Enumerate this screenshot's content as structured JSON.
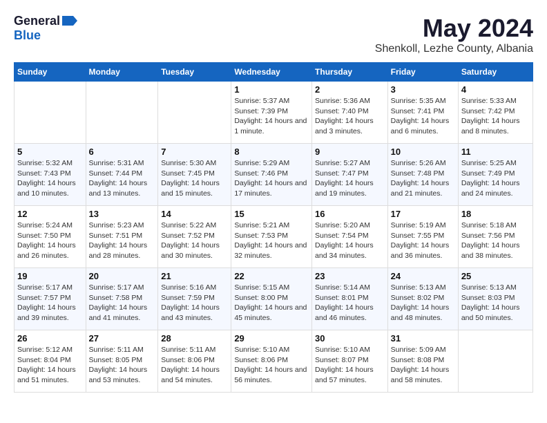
{
  "logo": {
    "general": "General",
    "blue": "Blue"
  },
  "header": {
    "month": "May 2024",
    "location": "Shenkoll, Lezhe County, Albania"
  },
  "days_of_week": [
    "Sunday",
    "Monday",
    "Tuesday",
    "Wednesday",
    "Thursday",
    "Friday",
    "Saturday"
  ],
  "weeks": [
    [
      {
        "day": null
      },
      {
        "day": null
      },
      {
        "day": null
      },
      {
        "day": 1,
        "sunrise": "Sunrise: 5:37 AM",
        "sunset": "Sunset: 7:39 PM",
        "daylight": "Daylight: 14 hours and 1 minute."
      },
      {
        "day": 2,
        "sunrise": "Sunrise: 5:36 AM",
        "sunset": "Sunset: 7:40 PM",
        "daylight": "Daylight: 14 hours and 3 minutes."
      },
      {
        "day": 3,
        "sunrise": "Sunrise: 5:35 AM",
        "sunset": "Sunset: 7:41 PM",
        "daylight": "Daylight: 14 hours and 6 minutes."
      },
      {
        "day": 4,
        "sunrise": "Sunrise: 5:33 AM",
        "sunset": "Sunset: 7:42 PM",
        "daylight": "Daylight: 14 hours and 8 minutes."
      }
    ],
    [
      {
        "day": 5,
        "sunrise": "Sunrise: 5:32 AM",
        "sunset": "Sunset: 7:43 PM",
        "daylight": "Daylight: 14 hours and 10 minutes."
      },
      {
        "day": 6,
        "sunrise": "Sunrise: 5:31 AM",
        "sunset": "Sunset: 7:44 PM",
        "daylight": "Daylight: 14 hours and 13 minutes."
      },
      {
        "day": 7,
        "sunrise": "Sunrise: 5:30 AM",
        "sunset": "Sunset: 7:45 PM",
        "daylight": "Daylight: 14 hours and 15 minutes."
      },
      {
        "day": 8,
        "sunrise": "Sunrise: 5:29 AM",
        "sunset": "Sunset: 7:46 PM",
        "daylight": "Daylight: 14 hours and 17 minutes."
      },
      {
        "day": 9,
        "sunrise": "Sunrise: 5:27 AM",
        "sunset": "Sunset: 7:47 PM",
        "daylight": "Daylight: 14 hours and 19 minutes."
      },
      {
        "day": 10,
        "sunrise": "Sunrise: 5:26 AM",
        "sunset": "Sunset: 7:48 PM",
        "daylight": "Daylight: 14 hours and 21 minutes."
      },
      {
        "day": 11,
        "sunrise": "Sunrise: 5:25 AM",
        "sunset": "Sunset: 7:49 PM",
        "daylight": "Daylight: 14 hours and 24 minutes."
      }
    ],
    [
      {
        "day": 12,
        "sunrise": "Sunrise: 5:24 AM",
        "sunset": "Sunset: 7:50 PM",
        "daylight": "Daylight: 14 hours and 26 minutes."
      },
      {
        "day": 13,
        "sunrise": "Sunrise: 5:23 AM",
        "sunset": "Sunset: 7:51 PM",
        "daylight": "Daylight: 14 hours and 28 minutes."
      },
      {
        "day": 14,
        "sunrise": "Sunrise: 5:22 AM",
        "sunset": "Sunset: 7:52 PM",
        "daylight": "Daylight: 14 hours and 30 minutes."
      },
      {
        "day": 15,
        "sunrise": "Sunrise: 5:21 AM",
        "sunset": "Sunset: 7:53 PM",
        "daylight": "Daylight: 14 hours and 32 minutes."
      },
      {
        "day": 16,
        "sunrise": "Sunrise: 5:20 AM",
        "sunset": "Sunset: 7:54 PM",
        "daylight": "Daylight: 14 hours and 34 minutes."
      },
      {
        "day": 17,
        "sunrise": "Sunrise: 5:19 AM",
        "sunset": "Sunset: 7:55 PM",
        "daylight": "Daylight: 14 hours and 36 minutes."
      },
      {
        "day": 18,
        "sunrise": "Sunrise: 5:18 AM",
        "sunset": "Sunset: 7:56 PM",
        "daylight": "Daylight: 14 hours and 38 minutes."
      }
    ],
    [
      {
        "day": 19,
        "sunrise": "Sunrise: 5:17 AM",
        "sunset": "Sunset: 7:57 PM",
        "daylight": "Daylight: 14 hours and 39 minutes."
      },
      {
        "day": 20,
        "sunrise": "Sunrise: 5:17 AM",
        "sunset": "Sunset: 7:58 PM",
        "daylight": "Daylight: 14 hours and 41 minutes."
      },
      {
        "day": 21,
        "sunrise": "Sunrise: 5:16 AM",
        "sunset": "Sunset: 7:59 PM",
        "daylight": "Daylight: 14 hours and 43 minutes."
      },
      {
        "day": 22,
        "sunrise": "Sunrise: 5:15 AM",
        "sunset": "Sunset: 8:00 PM",
        "daylight": "Daylight: 14 hours and 45 minutes."
      },
      {
        "day": 23,
        "sunrise": "Sunrise: 5:14 AM",
        "sunset": "Sunset: 8:01 PM",
        "daylight": "Daylight: 14 hours and 46 minutes."
      },
      {
        "day": 24,
        "sunrise": "Sunrise: 5:13 AM",
        "sunset": "Sunset: 8:02 PM",
        "daylight": "Daylight: 14 hours and 48 minutes."
      },
      {
        "day": 25,
        "sunrise": "Sunrise: 5:13 AM",
        "sunset": "Sunset: 8:03 PM",
        "daylight": "Daylight: 14 hours and 50 minutes."
      }
    ],
    [
      {
        "day": 26,
        "sunrise": "Sunrise: 5:12 AM",
        "sunset": "Sunset: 8:04 PM",
        "daylight": "Daylight: 14 hours and 51 minutes."
      },
      {
        "day": 27,
        "sunrise": "Sunrise: 5:11 AM",
        "sunset": "Sunset: 8:05 PM",
        "daylight": "Daylight: 14 hours and 53 minutes."
      },
      {
        "day": 28,
        "sunrise": "Sunrise: 5:11 AM",
        "sunset": "Sunset: 8:06 PM",
        "daylight": "Daylight: 14 hours and 54 minutes."
      },
      {
        "day": 29,
        "sunrise": "Sunrise: 5:10 AM",
        "sunset": "Sunset: 8:06 PM",
        "daylight": "Daylight: 14 hours and 56 minutes."
      },
      {
        "day": 30,
        "sunrise": "Sunrise: 5:10 AM",
        "sunset": "Sunset: 8:07 PM",
        "daylight": "Daylight: 14 hours and 57 minutes."
      },
      {
        "day": 31,
        "sunrise": "Sunrise: 5:09 AM",
        "sunset": "Sunset: 8:08 PM",
        "daylight": "Daylight: 14 hours and 58 minutes."
      },
      {
        "day": null
      }
    ]
  ]
}
